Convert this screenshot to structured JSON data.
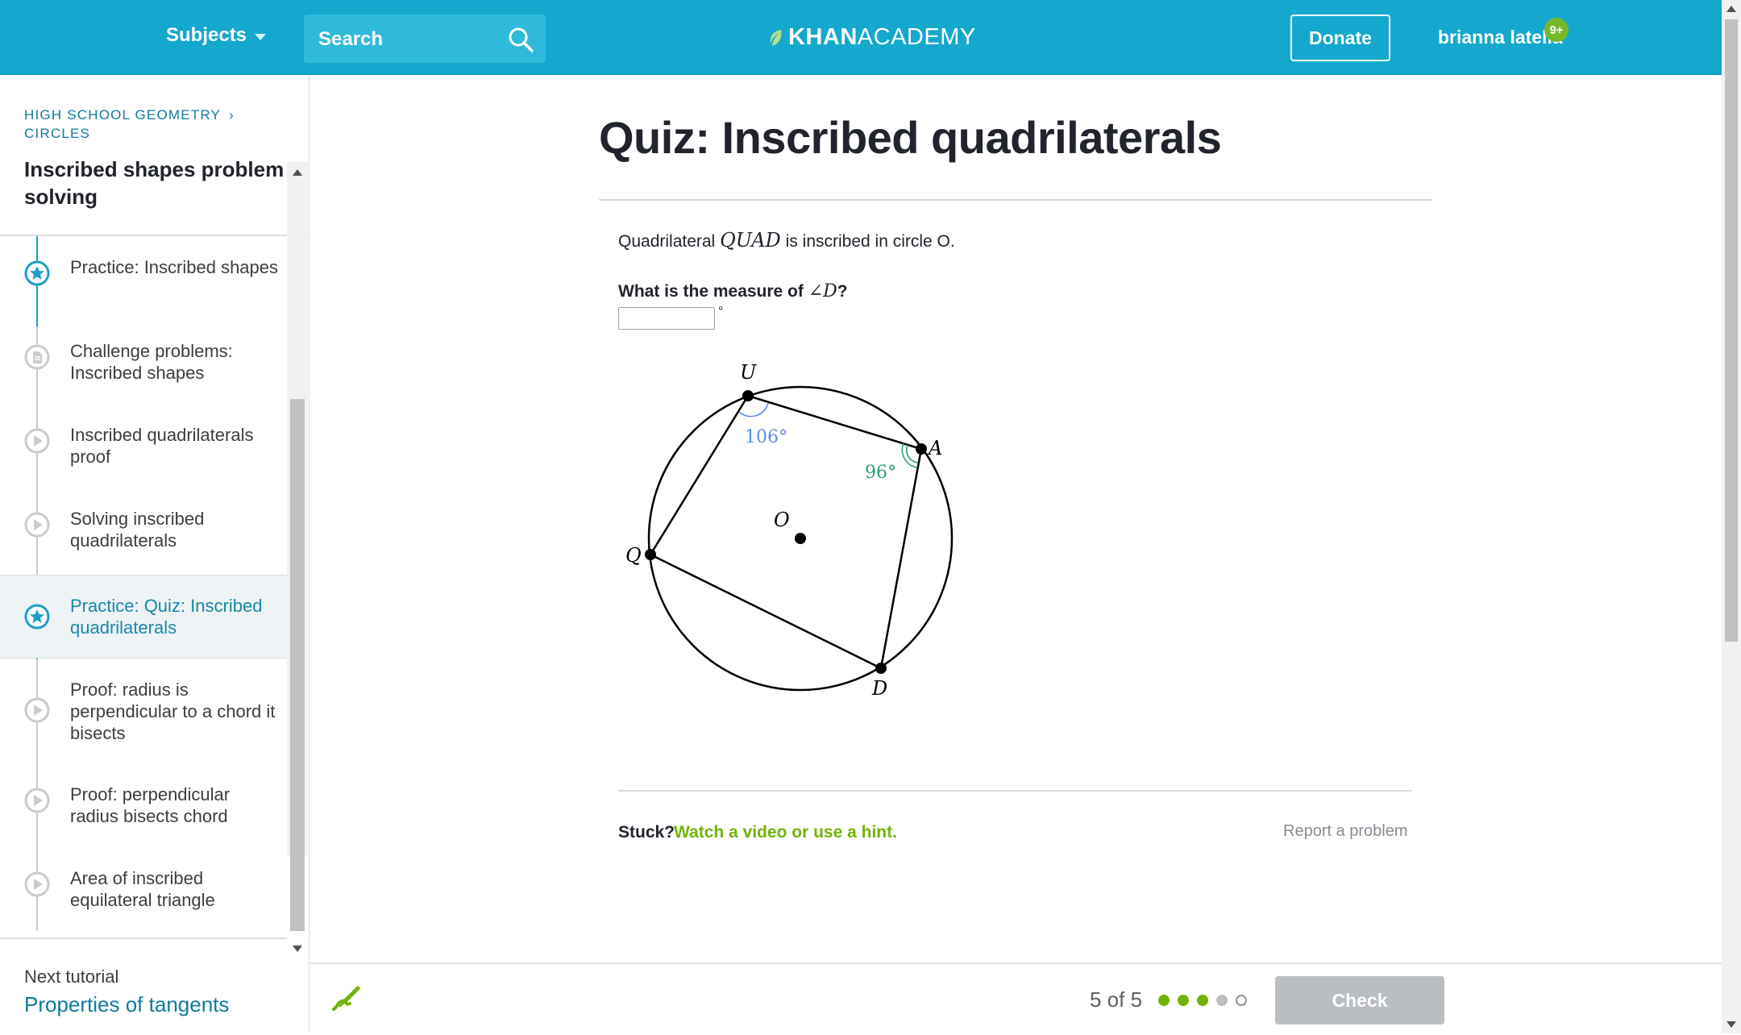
{
  "header": {
    "subjects_label": "Subjects",
    "search_placeholder": "Search",
    "logo_brand_bold": "KHAN",
    "logo_brand_light": "ACADEMY",
    "donate_label": "Donate",
    "username": "brianna latella",
    "notification_count": "9+",
    "brand_color": "#14a8ce"
  },
  "sidebar": {
    "breadcrumb_course": "HIGH SCHOOL GEOMETRY",
    "breadcrumb_unit": "CIRCLES",
    "title": "Inscribed shapes problem solving",
    "items": [
      {
        "label": "Practice: Inscribed shapes",
        "icon": "star-icon",
        "status": "mastered"
      },
      {
        "label": "Challenge problems: Inscribed shapes",
        "icon": "article-icon",
        "status": "not-started"
      },
      {
        "label": "Inscribed quadrilaterals proof",
        "icon": "play-icon",
        "status": "not-started"
      },
      {
        "label": "Solving inscribed quadrilaterals",
        "icon": "play-icon",
        "status": "not-started"
      },
      {
        "label": "Practice: Quiz: Inscribed quadrilaterals",
        "icon": "star-icon",
        "status": "current"
      },
      {
        "label": "Proof: radius is perpendicular to a chord it bisects",
        "icon": "play-icon",
        "status": "not-started"
      },
      {
        "label": "Proof: perpendicular radius bisects chord",
        "icon": "play-icon",
        "status": "not-started"
      },
      {
        "label": "Area of inscribed equilateral triangle",
        "icon": "play-icon",
        "status": "not-started"
      }
    ],
    "next_tutorial_label": "Next tutorial",
    "next_tutorial_link": "Properties of tangents"
  },
  "main": {
    "quiz_title": "Quiz: Inscribed quadrilaterals",
    "problem_prefix": "Quadrilateral ",
    "problem_math": "QUAD",
    "problem_suffix": " is inscribed in circle O.",
    "question_prefix": "What is the measure of ",
    "question_math": "∠D",
    "question_suffix": "?",
    "answer_value": "",
    "degree_symbol": "°",
    "figure": {
      "labels": {
        "U": "U",
        "A": "A",
        "D": "D",
        "Q": "Q",
        "O": "O"
      },
      "angle_U": "106°",
      "angle_A": "96°",
      "angle_U_color": "#5e8ee0",
      "angle_A_color": "#2aa173"
    },
    "stuck_label": "Stuck?",
    "hint_link": "Watch a video or use a hint.",
    "report_link": "Report a problem"
  },
  "footer": {
    "progress_text": "5 of 5",
    "progress_dots": [
      "correct",
      "correct",
      "correct",
      "pending",
      "current"
    ],
    "check_label": "Check",
    "correct_color": "#71b307"
  }
}
